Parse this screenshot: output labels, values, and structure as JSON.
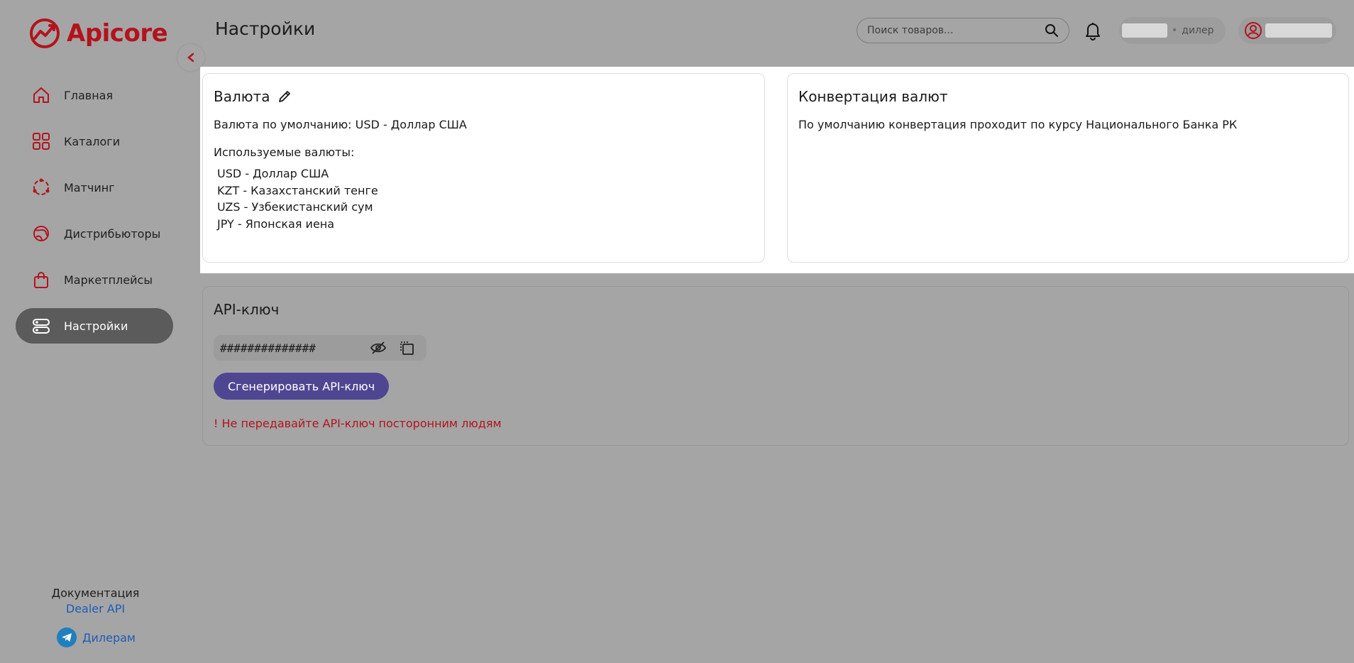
{
  "app": {
    "logo_text": "Apicore",
    "brand_color": "#b3131d"
  },
  "header": {
    "title": "Настройки",
    "search_placeholder": "Поиск товаров...",
    "user_role": "дилер"
  },
  "sidebar": {
    "items": [
      {
        "label": "Главная",
        "icon": "home-icon"
      },
      {
        "label": "Каталоги",
        "icon": "grid-icon"
      },
      {
        "label": "Матчинг",
        "icon": "matching-icon"
      },
      {
        "label": "Дистрибьюторы",
        "icon": "globe-icon"
      },
      {
        "label": "Маркетплейсы",
        "icon": "bag-icon"
      },
      {
        "label": "Настройки",
        "icon": "settings-icon",
        "active": true
      }
    ],
    "docs_title": "Документация",
    "docs_link": "Dealer API",
    "telegram_link": "Дилерам"
  },
  "currency": {
    "title": "Валюта",
    "default_label": "Валюта по умолчанию: USD - Доллар США",
    "used_label": "Используемые валюты:",
    "list": [
      "USD - Доллар США",
      "KZT - Казахстанский тенге",
      "UZS - Узбекистанский сум",
      "JPY - Японская иена"
    ]
  },
  "conversion": {
    "title": "Конвертация валют",
    "text": "По умолчанию конвертация проходит по курсу Национального Банка РК"
  },
  "api": {
    "title": "API-ключ",
    "key_value": "##############",
    "generate_label": "Сгенерировать API-ключ",
    "warning": "! Не передавайте API-ключ посторонним людям"
  }
}
